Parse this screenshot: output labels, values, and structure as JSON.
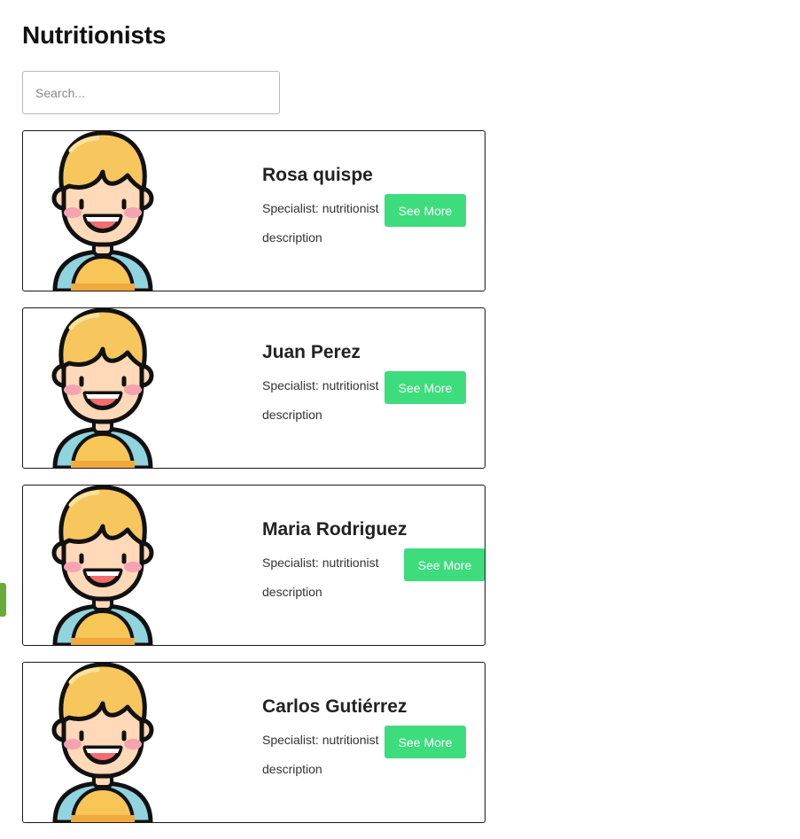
{
  "page": {
    "title": "Nutritionists"
  },
  "search": {
    "placeholder": "Search...",
    "value": ""
  },
  "cards": [
    {
      "name": "Rosa quispe",
      "specialist": "Specialist: nutritionist",
      "description": "description",
      "button_label": "See More",
      "avatar_icon": "boy-avatar-icon"
    },
    {
      "name": "Juan Perez",
      "specialist": "Specialist: nutritionist",
      "description": "description",
      "button_label": "See More",
      "avatar_icon": "boy-avatar-icon"
    },
    {
      "name": "Maria Rodriguez",
      "specialist": "Specialist: nutritionist",
      "description": "description",
      "button_label": "See More",
      "avatar_icon": "boy-avatar-icon"
    },
    {
      "name": "Carlos Gutiérrez",
      "specialist": "Specialist: nutritionist",
      "description": "description",
      "button_label": "See More",
      "avatar_icon": "boy-avatar-icon"
    }
  ],
  "colors": {
    "button": "#3ddc7d",
    "card_border": "#1a1a1a",
    "side_tab": "#6aaa3a",
    "hair": "#f7c65c",
    "skin": "#ffd9b8",
    "shirt": "#f8c557",
    "sleeve": "#8fd4de"
  }
}
